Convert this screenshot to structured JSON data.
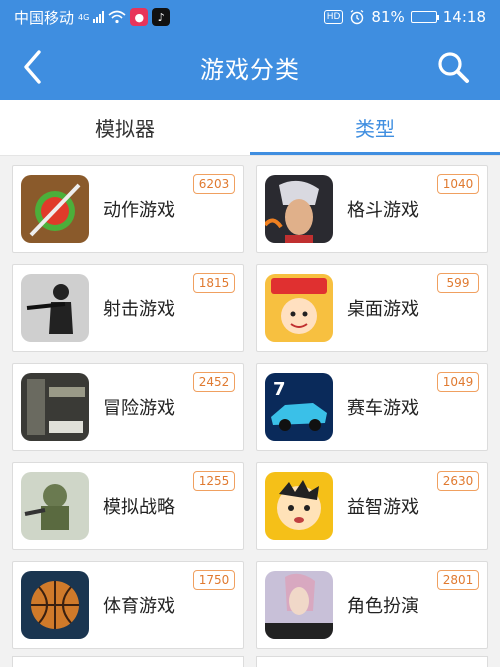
{
  "status_bar": {
    "carrier": "中国移动",
    "network": "4G",
    "app_badge_1_icon": "music-app-icon",
    "app_badge_2_icon": "tiktok-icon",
    "hd": "HD",
    "battery": "81%",
    "battery_level": 0.81,
    "time": "14:18"
  },
  "nav": {
    "title": "游戏分类",
    "back_icon": "back-chevron-icon",
    "search_icon": "search-icon"
  },
  "tabs": [
    {
      "label": "模拟器",
      "active": false
    },
    {
      "label": "类型",
      "active": true
    }
  ],
  "categories": [
    {
      "label": "动作游戏",
      "count": "6203",
      "icon": "fruit-ninja-icon"
    },
    {
      "label": "格斗游戏",
      "count": "1040",
      "icon": "fighter-portrait-icon"
    },
    {
      "label": "射击游戏",
      "count": "1815",
      "icon": "soldier-icon"
    },
    {
      "label": "桌面游戏",
      "count": "599",
      "icon": "monopoly-icon"
    },
    {
      "label": "冒险游戏",
      "count": "2452",
      "icon": "resident-evil-icon"
    },
    {
      "label": "赛车游戏",
      "count": "1049",
      "icon": "race-car-icon"
    },
    {
      "label": "模拟战略",
      "count": "1255",
      "icon": "mech-robot-icon"
    },
    {
      "label": "益智游戏",
      "count": "2630",
      "icon": "cartoon-face-icon"
    },
    {
      "label": "体育游戏",
      "count": "1750",
      "icon": "basketball-icon"
    },
    {
      "label": "角色扮演",
      "count": "2801",
      "icon": "final-fantasy-icon"
    }
  ],
  "colors": {
    "primary": "#3f8ee0",
    "count_badge": "#e07a30"
  }
}
